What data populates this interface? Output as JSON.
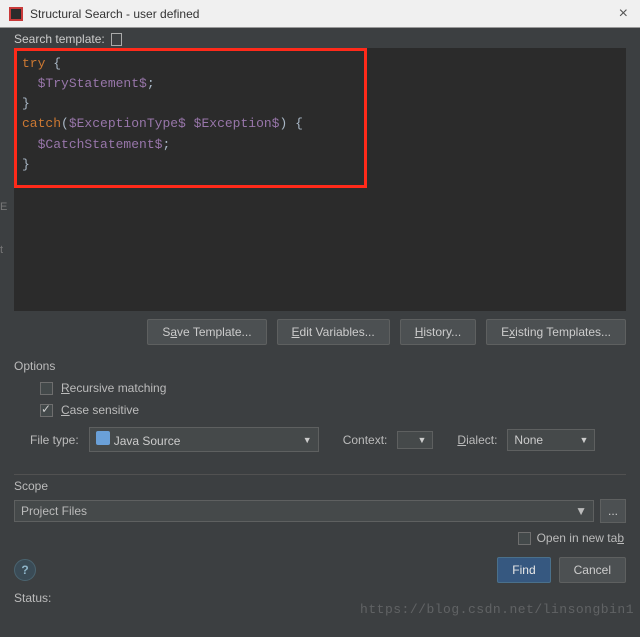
{
  "window": {
    "title": "Structural Search - user defined"
  },
  "template": {
    "label": "Search template:",
    "code_tokens": [
      [
        {
          "t": "try",
          "c": "kw"
        },
        {
          "t": " {",
          "c": "punct"
        }
      ],
      [
        {
          "t": "  ",
          "c": "punct"
        },
        {
          "t": "$TryStatement$",
          "c": "var"
        },
        {
          "t": ";",
          "c": "punct"
        }
      ],
      [
        {
          "t": "}",
          "c": "punct"
        }
      ],
      [
        {
          "t": "catch",
          "c": "kw"
        },
        {
          "t": "(",
          "c": "punct"
        },
        {
          "t": "$ExceptionType$",
          "c": "var"
        },
        {
          "t": " ",
          "c": "punct"
        },
        {
          "t": "$Exception$",
          "c": "var"
        },
        {
          "t": ") {",
          "c": "punct"
        }
      ],
      [
        {
          "t": "  ",
          "c": "punct"
        },
        {
          "t": "$CatchStatement$",
          "c": "var"
        },
        {
          "t": ";",
          "c": "punct"
        }
      ],
      [
        {
          "t": "}",
          "c": "punct"
        }
      ]
    ]
  },
  "buttons": {
    "save_template": "Save Template...",
    "edit_vars": "Edit Variables...",
    "history": "History...",
    "existing": "Existing Templates..."
  },
  "options": {
    "heading": "Options",
    "recursive": "Recursive matching",
    "recursive_checked": false,
    "case_sensitive": "Case sensitive",
    "case_sensitive_checked": true
  },
  "fields": {
    "filetype_label": "File type:",
    "filetype_value": "Java Source",
    "context_label": "Context:",
    "context_value": "",
    "dialect_label": "Dialect:",
    "dialect_value": "None"
  },
  "scope": {
    "label": "Scope",
    "value": "Project Files",
    "open_tab": "Open in new tab",
    "open_tab_checked": false
  },
  "bottom": {
    "find": "Find",
    "cancel": "Cancel",
    "status_label": "Status:"
  },
  "watermark": "https://blog.csdn.net/linsongbin1"
}
